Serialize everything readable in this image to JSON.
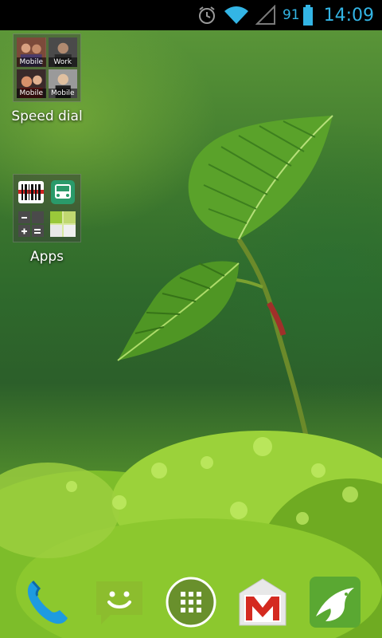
{
  "status_bar": {
    "battery_percent": "91",
    "time": "14:09",
    "icons": [
      "alarm-icon",
      "wifi-icon",
      "signal-icon",
      "battery-icon"
    ],
    "accent_color": "#33b5e5"
  },
  "folders": [
    {
      "label": "Speed dial",
      "contacts": [
        {
          "label": "Mobile"
        },
        {
          "label": "Work"
        },
        {
          "label": "Mobile"
        },
        {
          "label": "Mobile"
        }
      ]
    },
    {
      "label": "Apps",
      "apps": [
        "barcode-scanner-icon",
        "transit-bus-icon",
        "calculator-icon",
        "puzzle-grid-icon"
      ]
    }
  ],
  "dock": {
    "items": [
      "phone-icon",
      "messaging-icon",
      "all-apps-icon",
      "gmail-icon",
      "dolphin-browser-icon"
    ]
  }
}
